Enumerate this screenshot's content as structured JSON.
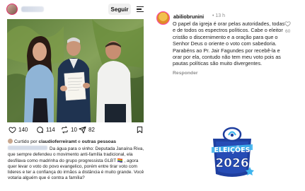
{
  "post": {
    "follow_label": "Seguir",
    "actions": {
      "likes": "140",
      "comments": "114",
      "reposts": "10",
      "shares": "82"
    },
    "liked_by": {
      "prefix": "Curtido por ",
      "user": "claudioferreiramt",
      "connector": " e ",
      "others": "outras pessoas"
    },
    "caption": "Da água para o vinho: Deputada Janaína Riva, que sempre defendeu o movimento anti-família tradicional, ela desfilava como madrinha do grupo progressista GLBT 🏳️‍🌈 , agora quer levar o voto do povo evangelico, porém entre tirar voto com lideres e ter a confiança do irmãos a distância é muito grande. Você votaria alguém que é contra a família?",
    "paper_text": "TERMO DE FILIAÇÃO"
  },
  "comment": {
    "username": "abiliobrunini",
    "time": "• 13 h",
    "text": "O papel da igreja é orar pelas autoridades, todas e de todos os espectros políticos. Cabe o eleitor cristão o discernimento e a oração para que o Senhor Deus o oriente o voto com sabedoria. Parabéns ao Pr. Jair Fagundes por recebê-la e orar por ela, contudo não tem meu voto pois as pautas políticas são muito divergentes.",
    "reply_label": "Responder",
    "like_count": "60"
  },
  "logo": {
    "line1": "ELEIÇÕES",
    "line2": "2026"
  },
  "colors": {
    "logo_blue": "#1f3f9f",
    "logo_cyan": "#3fb4ee",
    "seguir_bg": "#efefef",
    "muted": "#8e8e8e"
  }
}
